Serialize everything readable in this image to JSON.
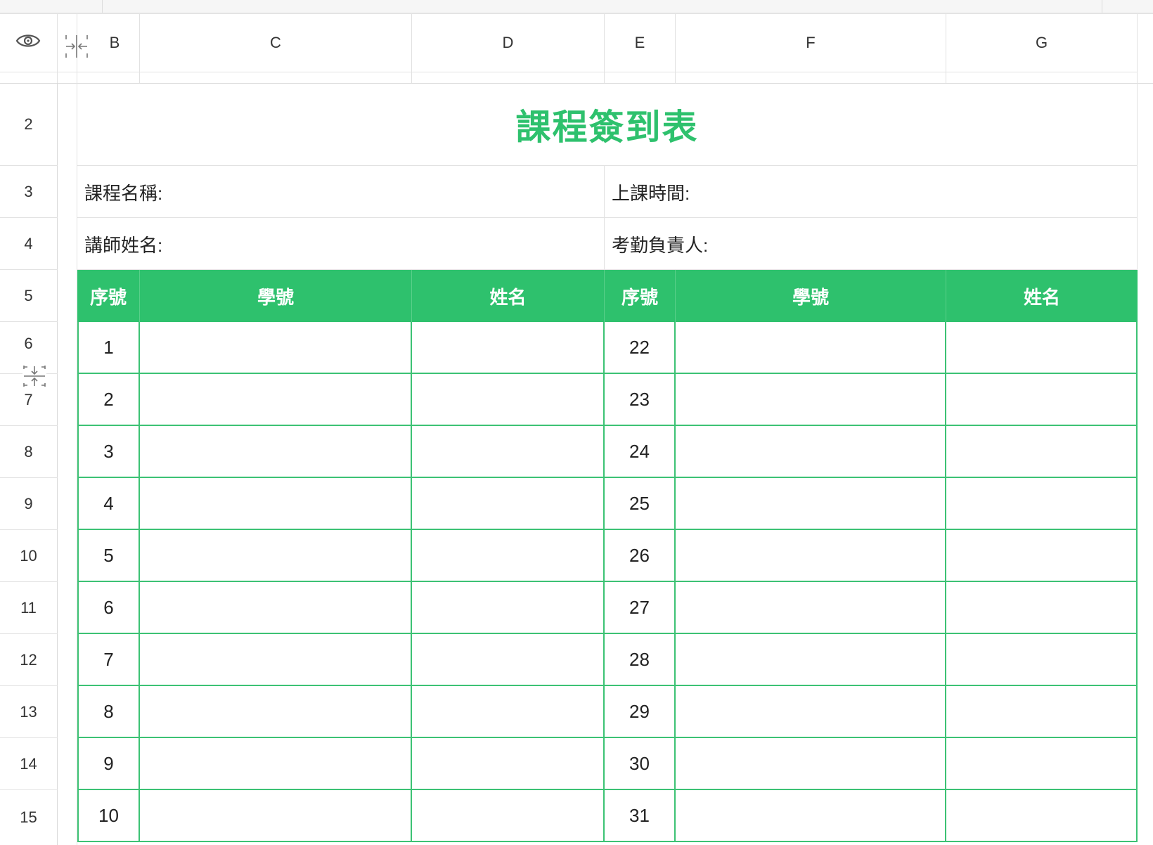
{
  "column_headers": [
    "B",
    "C",
    "D",
    "E",
    "F",
    "G"
  ],
  "row_numbers": [
    "2",
    "3",
    "4",
    "5",
    "6",
    "7",
    "8",
    "9",
    "10",
    "11",
    "12",
    "13",
    "14",
    "15"
  ],
  "title": "課程簽到表",
  "info": {
    "course_name_label": "課程名稱:",
    "class_time_label": "上課時間:",
    "teacher_name_label": "講師姓名:",
    "attendance_owner_label": "考勤負責人:"
  },
  "table_header": [
    "序號",
    "學號",
    "姓名",
    "序號",
    "學號",
    "姓名"
  ],
  "rows": [
    {
      "left_no": "1",
      "right_no": "22"
    },
    {
      "left_no": "2",
      "right_no": "23"
    },
    {
      "left_no": "3",
      "right_no": "24"
    },
    {
      "left_no": "4",
      "right_no": "25"
    },
    {
      "left_no": "5",
      "right_no": "26"
    },
    {
      "left_no": "6",
      "right_no": "27"
    },
    {
      "left_no": "7",
      "right_no": "28"
    },
    {
      "left_no": "8",
      "right_no": "29"
    },
    {
      "left_no": "9",
      "right_no": "30"
    },
    {
      "left_no": "10",
      "right_no": "31"
    }
  ],
  "icons": {
    "visibility": "eye-icon",
    "collapse_column": "collapse-column-icon",
    "collapse_row": "collapse-row-icon"
  },
  "colors": {
    "accent": "#2ec16d",
    "table_border": "#3cc274"
  }
}
